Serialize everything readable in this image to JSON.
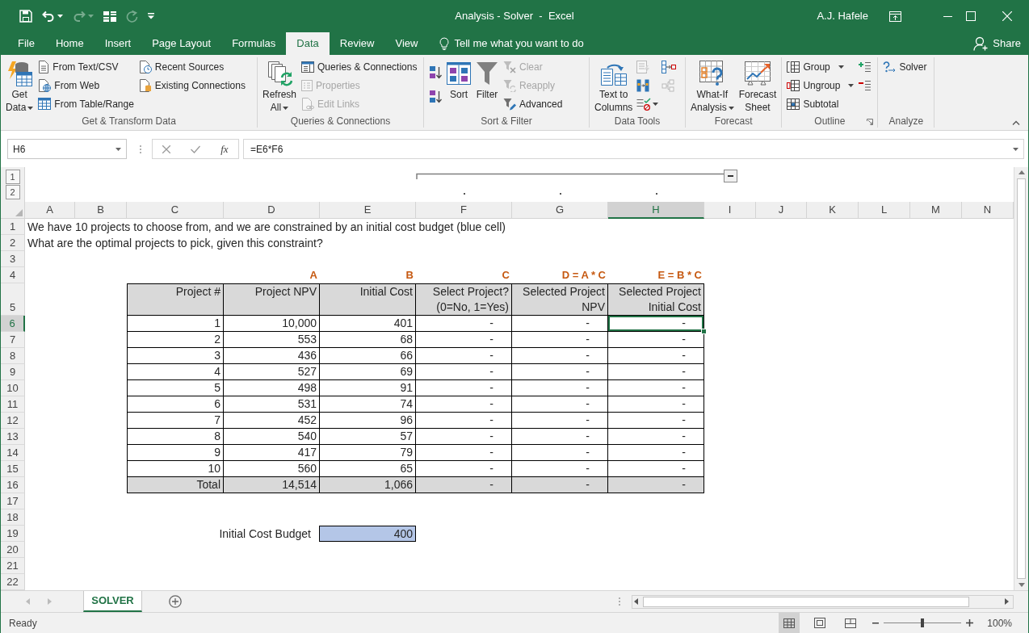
{
  "window": {
    "title": "Analysis - Solver  -  Excel",
    "user": "A.J. Hafele"
  },
  "quick_access": [
    {
      "kind": "save",
      "disabled": false
    },
    {
      "kind": "undo",
      "disabled": false
    },
    {
      "kind": "redo",
      "disabled": true
    },
    {
      "kind": "form",
      "disabled": false
    },
    {
      "kind": "repeat",
      "disabled": true
    },
    {
      "kind": "customize",
      "disabled": false
    }
  ],
  "tabs": [
    {
      "label": "File",
      "selected": false
    },
    {
      "label": "Home",
      "selected": false
    },
    {
      "label": "Insert",
      "selected": false
    },
    {
      "label": "Page Layout",
      "selected": false
    },
    {
      "label": "Formulas",
      "selected": false
    },
    {
      "label": "Data",
      "selected": true
    },
    {
      "label": "Review",
      "selected": false
    },
    {
      "label": "View",
      "selected": false
    }
  ],
  "tell_me": {
    "placeholder": "Tell me what you want to do"
  },
  "share": {
    "label": "Share"
  },
  "ribbon": {
    "groups": [
      {
        "label": "Get & Transform Data",
        "controls": [
          {
            "kind": "large",
            "label": "Get Data",
            "dropdown": true,
            "disabled": false
          },
          {
            "kind": "small",
            "label": "From Text/CSV",
            "dropdown": false,
            "disabled": false
          },
          {
            "kind": "small",
            "label": "From Web",
            "dropdown": false,
            "disabled": false
          },
          {
            "kind": "small",
            "label": "From Table/Range",
            "dropdown": false,
            "disabled": false
          },
          {
            "kind": "small",
            "label": "Recent Sources",
            "dropdown": false,
            "disabled": false
          },
          {
            "kind": "small",
            "label": "Existing Connections",
            "dropdown": false,
            "disabled": false
          }
        ]
      },
      {
        "label": "Queries & Connections",
        "controls": [
          {
            "kind": "large",
            "label": "Refresh All",
            "dropdown": true,
            "disabled": false
          },
          {
            "kind": "small",
            "label": "Queries & Connections",
            "dropdown": false,
            "disabled": false
          },
          {
            "kind": "small",
            "label": "Properties",
            "dropdown": false,
            "disabled": true
          },
          {
            "kind": "small",
            "label": "Edit Links",
            "dropdown": false,
            "disabled": true
          }
        ]
      },
      {
        "label": "Sort & Filter",
        "controls": [
          {
            "kind": "tall_icon",
            "dropdown": false,
            "disabled": false
          },
          {
            "kind": "tall_icon",
            "dropdown": false,
            "disabled": false
          },
          {
            "kind": "large",
            "label": "Sort",
            "dropdown": false,
            "disabled": false
          },
          {
            "kind": "large",
            "label": "Filter",
            "dropdown": false,
            "disabled": false
          },
          {
            "kind": "small",
            "label": "Clear",
            "dropdown": false,
            "disabled": true
          },
          {
            "kind": "small",
            "label": "Reapply",
            "dropdown": false,
            "disabled": true
          },
          {
            "kind": "small",
            "label": "Advanced",
            "dropdown": false,
            "disabled": false
          }
        ]
      },
      {
        "label": "Data Tools",
        "controls": [
          {
            "kind": "large",
            "label": "Text to Columns",
            "dropdown": false,
            "disabled": false
          },
          {
            "kind": "icon",
            "dropdown": false,
            "disabled": true
          },
          {
            "kind": "icon",
            "dropdown": false,
            "disabled": false
          },
          {
            "kind": "icon",
            "dropdown": true,
            "disabled": false
          },
          {
            "kind": "icon",
            "dropdown": false,
            "disabled": false
          },
          {
            "kind": "icon",
            "dropdown": false,
            "disabled": true
          }
        ]
      },
      {
        "label": "Forecast",
        "controls": [
          {
            "kind": "large",
            "label": "What-If Analysis",
            "dropdown": true,
            "disabled": false
          },
          {
            "kind": "large",
            "label": "Forecast Sheet",
            "dropdown": false,
            "disabled": false
          }
        ]
      },
      {
        "label": "Outline",
        "dialog_launcher": true,
        "controls": [
          {
            "kind": "small",
            "label": "Group",
            "dropdown": true,
            "disabled": false
          },
          {
            "kind": "small",
            "label": "Ungroup",
            "dropdown": true,
            "disabled": false
          },
          {
            "kind": "small",
            "label": "Subtotal",
            "dropdown": false,
            "disabled": false
          },
          {
            "kind": "icon",
            "dropdown": false,
            "disabled": false
          },
          {
            "kind": "icon",
            "dropdown": false,
            "disabled": false
          }
        ]
      },
      {
        "label": "Analyze",
        "controls": [
          {
            "kind": "small",
            "label": "Solver",
            "dropdown": false,
            "disabled": false
          }
        ]
      }
    ]
  },
  "formula_bar": {
    "name_box": "H6",
    "function_label": "fx",
    "formula": "=E6*F6"
  },
  "outline": {
    "levels": [
      "1",
      "2"
    ]
  },
  "sheet": {
    "columns": [
      {
        "label": "A",
        "selected": false
      },
      {
        "label": "B",
        "selected": false
      },
      {
        "label": "C",
        "selected": false
      },
      {
        "label": "D",
        "selected": false
      },
      {
        "label": "E",
        "selected": false
      },
      {
        "label": "F",
        "selected": false
      },
      {
        "label": "G",
        "selected": false
      },
      {
        "label": "H",
        "selected": true
      },
      {
        "label": "I",
        "selected": false
      },
      {
        "label": "J",
        "selected": false
      },
      {
        "label": "K",
        "selected": false
      },
      {
        "label": "L",
        "selected": false
      },
      {
        "label": "M",
        "selected": false
      },
      {
        "label": "N",
        "selected": false
      }
    ],
    "rows": [
      {
        "label": "1",
        "selected": false
      },
      {
        "label": "2",
        "selected": false
      },
      {
        "label": "3",
        "selected": false
      },
      {
        "label": "4",
        "selected": false
      },
      {
        "label": "5",
        "selected": false
      },
      {
        "label": "6",
        "selected": true
      },
      {
        "label": "7",
        "selected": false
      },
      {
        "label": "8",
        "selected": false
      },
      {
        "label": "9",
        "selected": false
      },
      {
        "label": "10",
        "selected": false
      },
      {
        "label": "11",
        "selected": false
      },
      {
        "label": "12",
        "selected": false
      },
      {
        "label": "13",
        "selected": false
      },
      {
        "label": "14",
        "selected": false
      },
      {
        "label": "15",
        "selected": false
      },
      {
        "label": "16",
        "selected": false
      },
      {
        "label": "17",
        "selected": false
      },
      {
        "label": "18",
        "selected": false
      },
      {
        "label": "19",
        "selected": false
      },
      {
        "label": "20",
        "selected": false
      },
      {
        "label": "21",
        "selected": false
      },
      {
        "label": "22",
        "selected": false
      }
    ]
  },
  "notes": [
    "We have 10 projects to choose from, and we are constrained by an initial cost budget (blue cell)",
    "What are the optimal projects to pick, given this constraint?"
  ],
  "table": {
    "formula_labels": [
      "A",
      "B",
      "C",
      "D = A * C",
      "E = B * C"
    ],
    "headers": [
      "Project #",
      "Project NPV",
      "Initial Cost",
      "Select Project? (0=No, 1=Yes)",
      "Selected Project NPV",
      "Selected Project Initial Cost"
    ],
    "rows": [
      {
        "kind": "data",
        "cells": [
          {
            "text": "1",
            "selected": false
          },
          {
            "text": "10,000",
            "selected": false
          },
          {
            "text": "401",
            "selected": false
          },
          {
            "text": "-",
            "selected": false
          },
          {
            "text": "-",
            "selected": false
          },
          {
            "text": "-",
            "selected": true
          }
        ]
      },
      {
        "kind": "data",
        "cells": [
          {
            "text": "2",
            "selected": false
          },
          {
            "text": "553",
            "selected": false
          },
          {
            "text": "68",
            "selected": false
          },
          {
            "text": "-",
            "selected": false
          },
          {
            "text": "-",
            "selected": false
          },
          {
            "text": "-",
            "selected": false
          }
        ]
      },
      {
        "kind": "data",
        "cells": [
          {
            "text": "3",
            "selected": false
          },
          {
            "text": "436",
            "selected": false
          },
          {
            "text": "66",
            "selected": false
          },
          {
            "text": "-",
            "selected": false
          },
          {
            "text": "-",
            "selected": false
          },
          {
            "text": "-",
            "selected": false
          }
        ]
      },
      {
        "kind": "data",
        "cells": [
          {
            "text": "4",
            "selected": false
          },
          {
            "text": "527",
            "selected": false
          },
          {
            "text": "69",
            "selected": false
          },
          {
            "text": "-",
            "selected": false
          },
          {
            "text": "-",
            "selected": false
          },
          {
            "text": "-",
            "selected": false
          }
        ]
      },
      {
        "kind": "data",
        "cells": [
          {
            "text": "5",
            "selected": false
          },
          {
            "text": "498",
            "selected": false
          },
          {
            "text": "91",
            "selected": false
          },
          {
            "text": "-",
            "selected": false
          },
          {
            "text": "-",
            "selected": false
          },
          {
            "text": "-",
            "selected": false
          }
        ]
      },
      {
        "kind": "data",
        "cells": [
          {
            "text": "6",
            "selected": false
          },
          {
            "text": "531",
            "selected": false
          },
          {
            "text": "74",
            "selected": false
          },
          {
            "text": "-",
            "selected": false
          },
          {
            "text": "-",
            "selected": false
          },
          {
            "text": "-",
            "selected": false
          }
        ]
      },
      {
        "kind": "data",
        "cells": [
          {
            "text": "7",
            "selected": false
          },
          {
            "text": "452",
            "selected": false
          },
          {
            "text": "96",
            "selected": false
          },
          {
            "text": "-",
            "selected": false
          },
          {
            "text": "-",
            "selected": false
          },
          {
            "text": "-",
            "selected": false
          }
        ]
      },
      {
        "kind": "data",
        "cells": [
          {
            "text": "8",
            "selected": false
          },
          {
            "text": "540",
            "selected": false
          },
          {
            "text": "57",
            "selected": false
          },
          {
            "text": "-",
            "selected": false
          },
          {
            "text": "-",
            "selected": false
          },
          {
            "text": "-",
            "selected": false
          }
        ]
      },
      {
        "kind": "data",
        "cells": [
          {
            "text": "9",
            "selected": false
          },
          {
            "text": "417",
            "selected": false
          },
          {
            "text": "79",
            "selected": false
          },
          {
            "text": "-",
            "selected": false
          },
          {
            "text": "-",
            "selected": false
          },
          {
            "text": "-",
            "selected": false
          }
        ]
      },
      {
        "kind": "data",
        "cells": [
          {
            "text": "10",
            "selected": false
          },
          {
            "text": "560",
            "selected": false
          },
          {
            "text": "65",
            "selected": false
          },
          {
            "text": "-",
            "selected": false
          },
          {
            "text": "-",
            "selected": false
          },
          {
            "text": "-",
            "selected": false
          }
        ]
      },
      {
        "kind": "total",
        "cells": [
          {
            "text": "Total",
            "selected": false
          },
          {
            "text": "14,514",
            "selected": false
          },
          {
            "text": "1,066",
            "selected": false
          },
          {
            "text": "-",
            "selected": false
          },
          {
            "text": "-",
            "selected": false
          },
          {
            "text": "-",
            "selected": false
          }
        ]
      }
    ]
  },
  "budget": {
    "label": "Initial Cost Budget",
    "value": "400"
  },
  "sheet_tabs": [
    {
      "label": "SOLVER",
      "selected": true
    }
  ],
  "status_bar": {
    "status": "Ready",
    "views": [
      {
        "kind": "normal",
        "selected": true
      },
      {
        "kind": "page_layout",
        "selected": false
      },
      {
        "kind": "page_break",
        "selected": false
      }
    ],
    "zoom": {
      "level": 0.5,
      "reading": "100%"
    }
  }
}
